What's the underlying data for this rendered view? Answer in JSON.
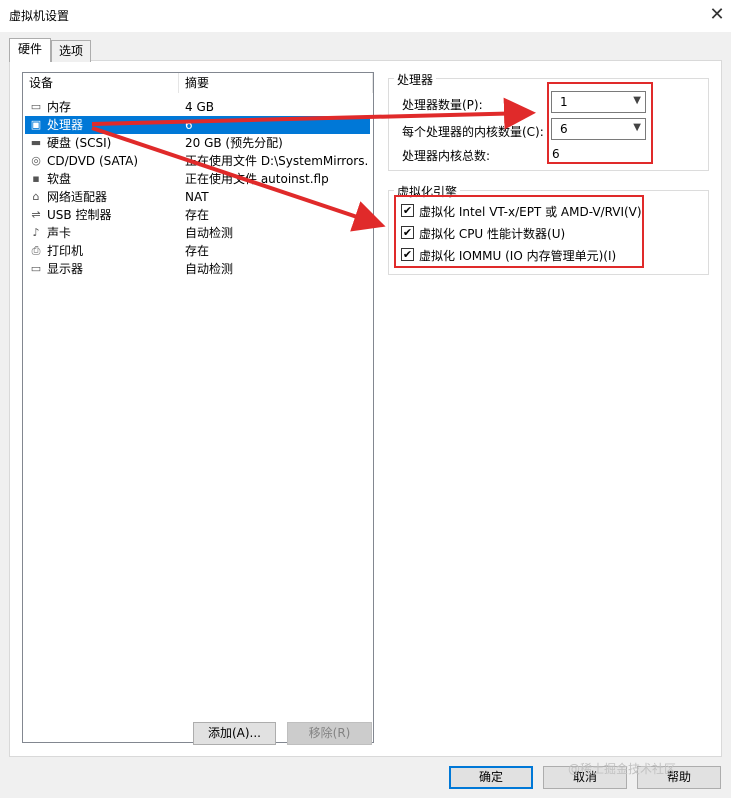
{
  "window": {
    "title": "虚拟机设置",
    "close_glyph": "✕"
  },
  "tabs": [
    {
      "label": "硬件"
    },
    {
      "label": "选项"
    }
  ],
  "device_list": {
    "columns": [
      "设备",
      "摘要"
    ],
    "rows": [
      {
        "icon": "memory-icon",
        "glyph": "▭",
        "device": "内存",
        "summary": "4 GB"
      },
      {
        "icon": "processor-icon",
        "glyph": "▣",
        "device": "处理器",
        "summary": "6"
      },
      {
        "icon": "hard-disk-icon",
        "glyph": "▬",
        "device": "硬盘 (SCSI)",
        "summary": "20 GB (预先分配)"
      },
      {
        "icon": "cd-dvd-icon",
        "glyph": "◎",
        "device": "CD/DVD (SATA)",
        "summary": "正在使用文件 D:\\SystemMirrors..."
      },
      {
        "icon": "floppy-icon",
        "glyph": "▪",
        "device": "软盘",
        "summary": "正在使用文件 autoinst.flp"
      },
      {
        "icon": "network-adapter-icon",
        "glyph": "⌂",
        "device": "网络适配器",
        "summary": "NAT"
      },
      {
        "icon": "usb-controller-icon",
        "glyph": "⇌",
        "device": "USB 控制器",
        "summary": "存在"
      },
      {
        "icon": "sound-card-icon",
        "glyph": "♪",
        "device": "声卡",
        "summary": "自动检测"
      },
      {
        "icon": "printer-icon",
        "glyph": "⎙",
        "device": "打印机",
        "summary": "存在"
      },
      {
        "icon": "display-icon",
        "glyph": "▭",
        "device": "显示器",
        "summary": "自动检测"
      }
    ],
    "selected": "处理器"
  },
  "buttons": {
    "add": "添加(A)...",
    "remove": "移除(R)",
    "ok": "确定",
    "cancel": "取消",
    "help": "帮助"
  },
  "processor": {
    "group_label": "处理器",
    "count_label": "处理器数量(P):",
    "count_value": "1",
    "cores_label": "每个处理器的内核数量(C):",
    "cores_value": "6",
    "total_label": "处理器内核总数:",
    "total_value": "6"
  },
  "virtualization": {
    "group_label": "虚拟化引擎",
    "options": [
      {
        "label": "虚拟化 Intel VT-x/EPT 或 AMD-V/RVI(V)",
        "checked": true
      },
      {
        "label": "虚拟化 CPU 性能计数器(U)",
        "checked": true
      },
      {
        "label": "虚拟化 IOMMU (IO 内存管理单元)(I)",
        "checked": true
      }
    ]
  },
  "watermark": "@稀土掘金技术社区",
  "colors": {
    "selection": "#0078d7",
    "annotation_red": "#e02a2a"
  }
}
